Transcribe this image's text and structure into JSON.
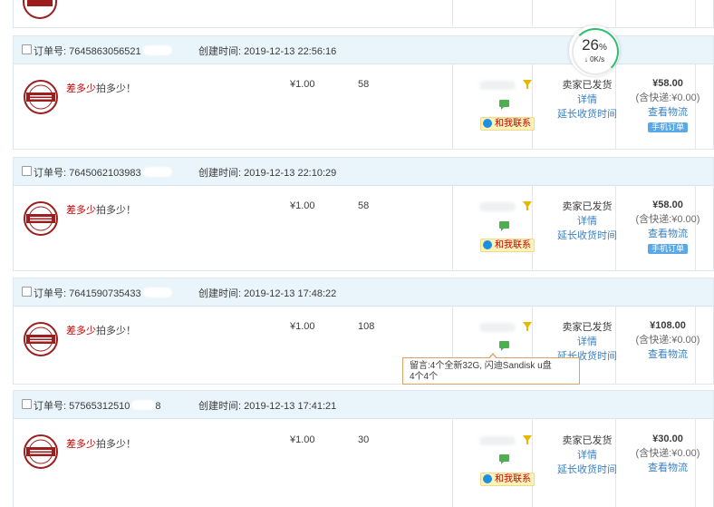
{
  "orders": [
    {
      "order_label": "订单号:",
      "order_no": "7645863056521",
      "created_label": "创建时间:",
      "created_time": "2019-12-13 22:56:16",
      "product_prefix": "差多少",
      "product_suffix": "拍多少！",
      "price": "¥1.00",
      "qty": "58",
      "contact": "和我联系",
      "status": "卖家已发货",
      "detail": "详情",
      "extend": "延长收货时间",
      "total": "¥58.00",
      "shipping": "(含快递:¥0.00)",
      "logistics": "查看物流",
      "mobile": "手机订单"
    },
    {
      "order_label": "订单号:",
      "order_no": "7645062103983",
      "created_label": "创建时间:",
      "created_time": "2019-12-13 22:10:29",
      "product_prefix": "差多少",
      "product_suffix": "拍多少！",
      "price": "¥1.00",
      "qty": "58",
      "contact": "和我联系",
      "status": "卖家已发货",
      "detail": "详情",
      "extend": "延长收货时间",
      "total": "¥58.00",
      "shipping": "(含快递:¥0.00)",
      "logistics": "查看物流",
      "mobile": "手机订单"
    },
    {
      "order_label": "订单号:",
      "order_no": "7641590735433",
      "created_label": "创建时间:",
      "created_time": "2019-12-13 17:48:22",
      "product_prefix": "差多少",
      "product_suffix": "拍多少！",
      "price": "¥1.00",
      "qty": "108",
      "status": "卖家已发货",
      "detail": "详情",
      "extend": "延长收货时间",
      "total": "¥108.00",
      "shipping": "(含快递:¥0.00)",
      "logistics": "查看物流"
    },
    {
      "order_label": "订单号:",
      "order_no": "57565312510",
      "order_no_tail": "8",
      "created_label": "创建时间:",
      "created_time": "2019-12-13 17:41:21",
      "product_prefix": "差多少",
      "product_suffix": "拍多少！",
      "price": "¥1.00",
      "qty": "30",
      "contact": "和我联系",
      "status": "卖家已发货",
      "detail": "详情",
      "extend": "延长收货时间",
      "total": "¥30.00",
      "shipping": "(含快递:¥0.00)",
      "logistics": "查看物流"
    }
  ],
  "tooltip": {
    "line1": "留言:4个全新32G, 闪迪Sandisk u盘",
    "line2": "4个4个"
  },
  "speed": {
    "percent": "26",
    "percent_sign": "%",
    "rate": "0K/s"
  },
  "colors": {
    "header_bg": "#e9f4fb",
    "link": "#3a7fc1",
    "product": "#c40000",
    "speed_ring": "#2ebf6e"
  },
  "icons": [
    "checkbox-icon",
    "seal-icon",
    "funnel-icon",
    "message-icon",
    "contact-icon",
    "down-arrow-icon"
  ]
}
